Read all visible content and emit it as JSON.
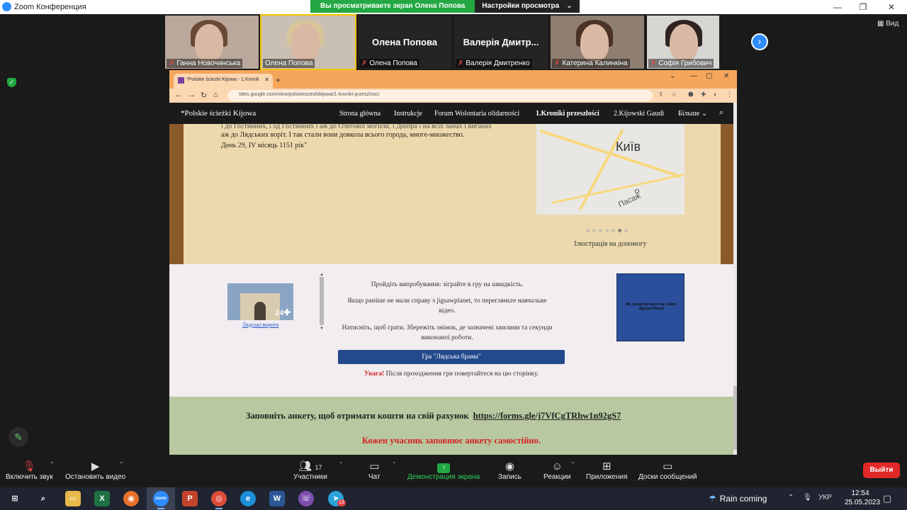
{
  "zoom": {
    "window_title": "Zoom Конференция",
    "share_banner": "Вы просматриваете экран Олена Попова",
    "view_settings": "Настройки просмотра",
    "view_button": "Вид",
    "leave": "Выйти"
  },
  "participants": [
    {
      "name": "Ганна Новочинська",
      "video": true,
      "muted": true
    },
    {
      "name": "Олена Попова",
      "video": true,
      "muted": false,
      "active": true
    },
    {
      "name": "Олена Попова",
      "display": "Олена Попова",
      "video": false,
      "muted": true
    },
    {
      "name": "Валерія Дмитренко",
      "display": "Валерія Дмитр...",
      "video": false,
      "muted": true
    },
    {
      "name": "Катерина Калинкіна",
      "video": true,
      "muted": true
    },
    {
      "name": "Софія Грибович",
      "video": true,
      "muted": true
    }
  ],
  "browser": {
    "tab_title": "*Polskie ścieżki Kijowa - 1.Kronik",
    "url": "sites.google.com/view/polskiesciezkikijowa/1-kroniki-przeszlosci"
  },
  "site": {
    "name": "*Polskie ścieżki Kijowa",
    "nav": [
      "Strona główna",
      "Instrukcje",
      "Forum Wolontaria olidarności",
      "1.Kroniki przeszłości",
      "2.Kijowski Gaudi",
      "Більше"
    ],
    "selected_nav": "1.Kroniki przeszłości"
  },
  "parchment": {
    "cut_line": "і до Гостинних, і од Гостинних і аж до Олегової могили, і Дніпра і на всіх ланах і виганах",
    "line1": "аж до Лядських воріт. І так стали вони довкола всього города, многе-множество.",
    "line2": "День 29, IV місяць 1151 рік\"",
    "map_city": "Київ",
    "map_street": "Пасаж",
    "caption": "Ілюстрація на допомогу"
  },
  "game": {
    "puzzle_pieces": "24",
    "puzzle_link": "Лядські ворота",
    "p1": "Пройдіть випробування: зіграйте в гру на швидкість.",
    "p2": "Якщо раніше не мали справу з jigsawplanet, то перегляньте навчальне відео.",
    "p3": "Натисніть, щоб грати. Збережіть знімок, де зазначені хвилини та секунди виконаної роботи.",
    "button": "Гра \"Лядська брама\"",
    "warn_label": "Увага!",
    "warn_text": "Після проходження гри повертайтеся на цю сторінку.",
    "video_card_title": "Як скласти пазл на сайті Jigsaw Planet"
  },
  "form": {
    "text": "Заповніть анкету, щоб отримати кошти на свій рахунок",
    "link": "https://forms.gle/j7VfCgTRhw1n92gS7",
    "note": "Кожен учасник заповнює анкету самостійно."
  },
  "controls": {
    "mute": "Включить звук",
    "video": "Остановить видео",
    "participants": "Участники",
    "participants_count": "17",
    "chat": "Чат",
    "share": "Демонстрация экрана",
    "record": "Запись",
    "reactions": "Реакции",
    "apps": "Приложения",
    "whiteboard": "Доски сообщений"
  },
  "taskbar": {
    "weather": "Rain coming",
    "lang": "УКР",
    "time": "12:54",
    "date": "25.05.2023",
    "telegram_badge": "13"
  },
  "colors": {
    "zoom_blue": "#2d8cff",
    "share_green": "#23a843",
    "leave_red": "#e02828",
    "site_nav": "#1b1b1b",
    "game_button": "#234a8c",
    "form_bg": "#b8c8a0",
    "warning_red": "#d32222"
  }
}
